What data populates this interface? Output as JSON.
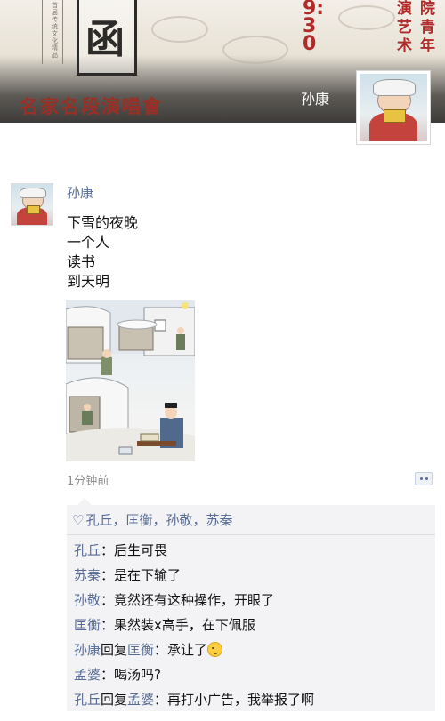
{
  "cover": {
    "emblem_glyph": "函",
    "vertical_text": "首届传统文化精品",
    "time_text": "9:30",
    "red_col_1": "院青年",
    "red_col_2": "演艺术",
    "banner": "名家名段演唱會",
    "profile_name": "孙康"
  },
  "post": {
    "author": "孙康",
    "lines": [
      "下雪的夜晚",
      "一个人",
      "读书",
      "到天明"
    ],
    "time_ago": "1分钟前"
  },
  "likes": [
    "孔丘",
    "匡衡",
    "孙敬",
    "苏秦"
  ],
  "comments": [
    {
      "author": "孔丘",
      "text": "：后生可畏"
    },
    {
      "author": "苏秦",
      "text": "：是在下输了"
    },
    {
      "author": "孙敬",
      "text": "：竟然还有这种操作，开眼了"
    },
    {
      "author": "匡衡",
      "text": "：果然装x高手，在下佩服"
    },
    {
      "author": "孙康",
      "reply_word": "回复",
      "reply_to": "匡衡",
      "text": "：承让了",
      "emoji": "wink"
    },
    {
      "author": "孟婆",
      "text": "：喝汤吗?"
    },
    {
      "author": "孔丘",
      "reply_word": "回复",
      "reply_to": "孟婆",
      "text": "：再打小广告，我举报了啊"
    }
  ],
  "colors": {
    "link": "#576b95",
    "banner": "#9a2f25",
    "accent_red": "#b12a2a"
  }
}
